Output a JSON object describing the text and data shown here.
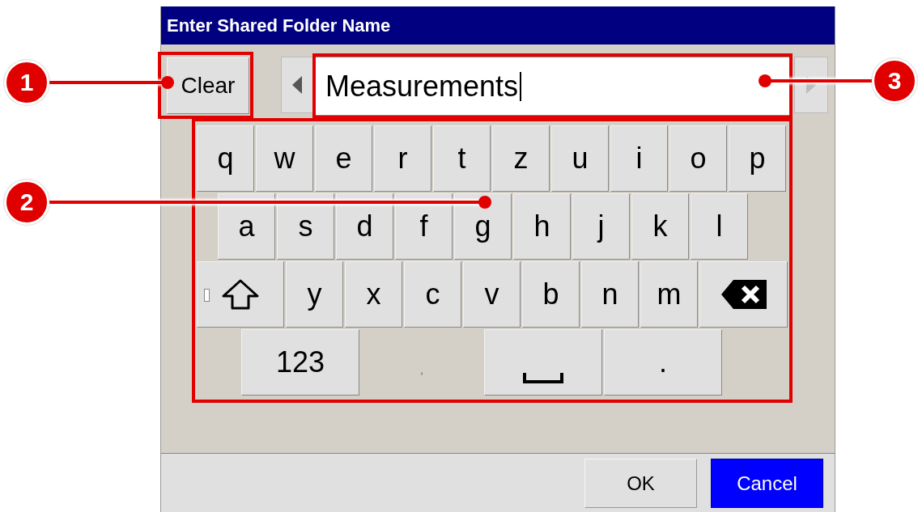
{
  "window": {
    "title": "Enter Shared Folder Name"
  },
  "clear_button": {
    "label": "Clear"
  },
  "scroll_left": {
    "disabled": false
  },
  "scroll_right": {
    "disabled": true
  },
  "name_field": {
    "value": "Measurements"
  },
  "keyboard": {
    "rows": [
      {
        "keys": [
          {
            "kind": "char",
            "label": "q"
          },
          {
            "kind": "char",
            "label": "w"
          },
          {
            "kind": "char",
            "label": "e"
          },
          {
            "kind": "char",
            "label": "r"
          },
          {
            "kind": "char",
            "label": "t"
          },
          {
            "kind": "char",
            "label": "z"
          },
          {
            "kind": "char",
            "label": "u"
          },
          {
            "kind": "char",
            "label": "i"
          },
          {
            "kind": "char",
            "label": "o"
          },
          {
            "kind": "char",
            "label": "p"
          }
        ]
      },
      {
        "keys": [
          {
            "kind": "char",
            "label": "a"
          },
          {
            "kind": "char",
            "label": "s"
          },
          {
            "kind": "char",
            "label": "d"
          },
          {
            "kind": "char",
            "label": "f"
          },
          {
            "kind": "char",
            "label": "g"
          },
          {
            "kind": "char",
            "label": "h"
          },
          {
            "kind": "char",
            "label": "j"
          },
          {
            "kind": "char",
            "label": "k"
          },
          {
            "kind": "char",
            "label": "l"
          }
        ]
      },
      {
        "keys": [
          {
            "kind": "shift"
          },
          {
            "kind": "char",
            "label": "y"
          },
          {
            "kind": "char",
            "label": "x"
          },
          {
            "kind": "char",
            "label": "c"
          },
          {
            "kind": "char",
            "label": "v"
          },
          {
            "kind": "char",
            "label": "b"
          },
          {
            "kind": "char",
            "label": "n"
          },
          {
            "kind": "char",
            "label": "m"
          },
          {
            "kind": "backspace"
          }
        ]
      },
      {
        "keys": [
          {
            "kind": "wide",
            "label": "123"
          },
          {
            "kind": "flat",
            "label": ","
          },
          {
            "kind": "space"
          },
          {
            "kind": "wide",
            "label": "."
          }
        ]
      }
    ]
  },
  "buttons": [
    {
      "label": "OK",
      "selected": false
    },
    {
      "label": "Cancel",
      "selected": true
    }
  ],
  "callouts": [
    {
      "number": "1"
    },
    {
      "number": "2"
    },
    {
      "number": "3"
    }
  ]
}
